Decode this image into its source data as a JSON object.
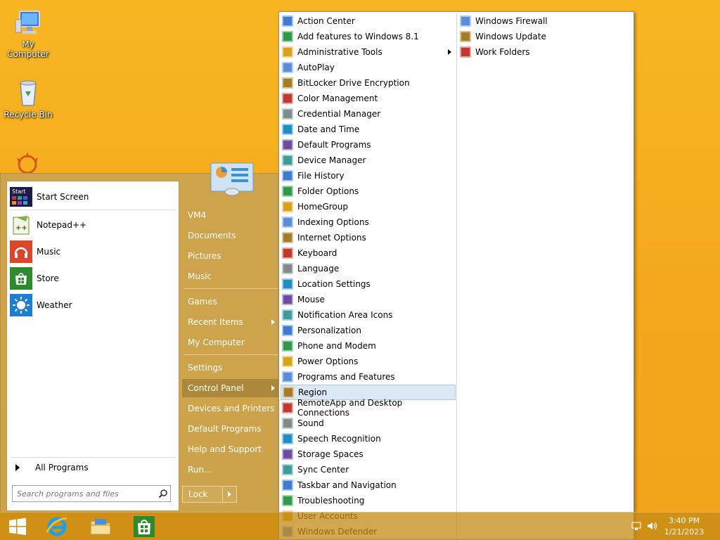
{
  "desktop": {
    "icons": [
      {
        "label": "My Computer"
      },
      {
        "label": "Recycle Bin"
      }
    ]
  },
  "start_menu": {
    "programs": [
      {
        "label": "Start Screen",
        "icon": "start-screen-icon"
      },
      {
        "label": "Notepad++",
        "icon": "notepad-plus-plus-icon"
      },
      {
        "label": "Music",
        "icon": "music-headphones-icon"
      },
      {
        "label": "Store",
        "icon": "store-icon"
      },
      {
        "label": "Weather",
        "icon": "weather-sun-icon"
      }
    ],
    "all_programs": "All Programs",
    "search_placeholder": "Search programs and files",
    "right_items": [
      {
        "label": "VM4"
      },
      {
        "label": "Documents"
      },
      {
        "label": "Pictures"
      },
      {
        "label": "Music"
      },
      {
        "label": "Games"
      },
      {
        "label": "Recent Items"
      },
      {
        "label": "My Computer"
      },
      {
        "label": "Settings"
      },
      {
        "label": "Control Panel"
      },
      {
        "label": "Devices and Printers"
      },
      {
        "label": "Default Programs"
      },
      {
        "label": "Help and Support"
      },
      {
        "label": "Run..."
      }
    ],
    "lock_label": "Lock"
  },
  "control_panel_menu": {
    "col1": [
      "Action Center",
      "Add features to Windows 8.1",
      "Administrative Tools",
      "AutoPlay",
      "BitLocker Drive Encryption",
      "Color Management",
      "Credential Manager",
      "Date and Time",
      "Default Programs",
      "Device Manager",
      "File History",
      "Folder Options",
      "HomeGroup",
      "Indexing Options",
      "Internet Options",
      "Keyboard",
      "Language",
      "Location Settings",
      "Mouse",
      "Notification Area Icons",
      "Personalization",
      "Phone and Modem",
      "Power Options",
      "Programs and Features",
      "Region",
      "RemoteApp and Desktop Connections",
      "Sound",
      "Speech Recognition",
      "Storage Spaces",
      "Sync Center",
      "Taskbar and Navigation",
      "Troubleshooting",
      "User Accounts",
      "Windows Defender"
    ],
    "col2": [
      "Windows Firewall",
      "Windows Update",
      "Work Folders"
    ],
    "highlighted": "Region"
  },
  "taskbar": {
    "time": "3:40 PM",
    "date": "1/21/2023"
  },
  "colors": {
    "desktop": "#f5ad1f",
    "highlight": "#dbe8f5"
  }
}
